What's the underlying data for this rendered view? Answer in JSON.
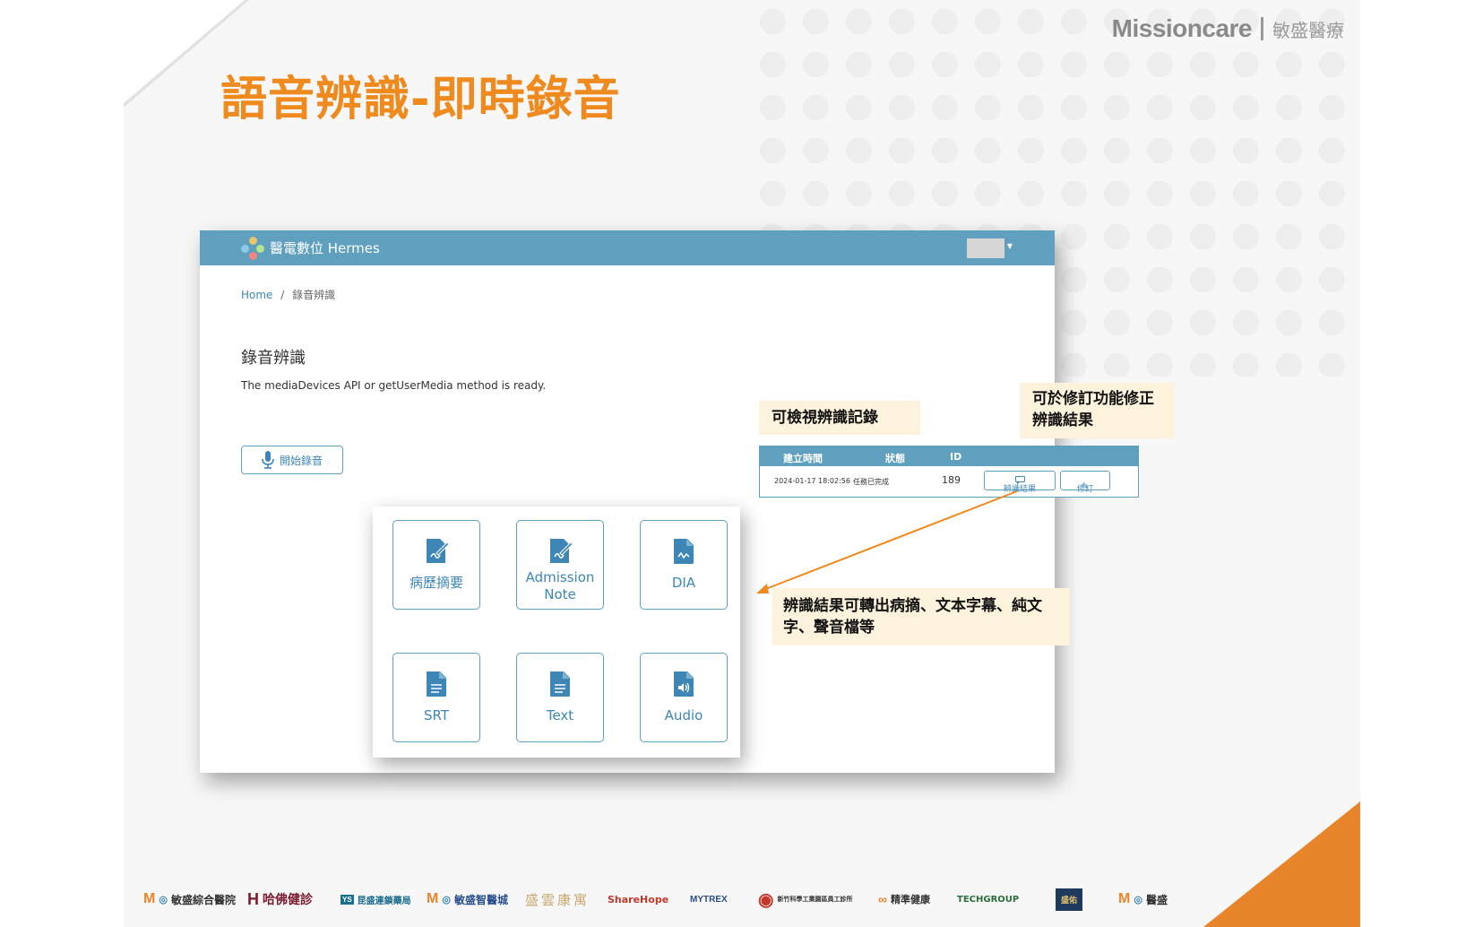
{
  "slide": {
    "brand_en": "Missioncare",
    "brand_zh": "敏盛醫療",
    "title": "語音辨識-即時錄音"
  },
  "app": {
    "name": "醫電數位 Hermes",
    "breadcrumb": {
      "home": "Home",
      "separator": "/",
      "current": "錄音辨識"
    },
    "heading": "錄音辨識",
    "status_message": "The mediaDevices API or getUserMedia method is ready.",
    "record_button": "開始錄音",
    "table": {
      "headers": [
        "建立時間",
        "狀態",
        "ID"
      ],
      "row": {
        "created": "2024-01-17 18:02:56",
        "status": "任務已完成",
        "id": "189"
      },
      "result_button": "辨識結果",
      "edit_button": "修訂"
    },
    "export_options": [
      {
        "label": "病歷摘要",
        "icon": "document-edit-icon"
      },
      {
        "label": "Admission Note",
        "icon": "document-edit-icon"
      },
      {
        "label": "DIA",
        "icon": "file-chart-icon"
      },
      {
        "label": "SRT",
        "icon": "file-text-icon"
      },
      {
        "label": "Text",
        "icon": "file-text-icon"
      },
      {
        "label": "Audio",
        "icon": "file-audio-icon"
      }
    ]
  },
  "callouts": {
    "view_records": "可檢視辨識記錄",
    "revise": "可於修訂功能修正辨識結果",
    "export": "辨識結果可轉出病摘、文本字幕、純文字、聲音檔等"
  },
  "partner_logos": [
    "敏盛綜合醫院",
    "哈佛健診",
    "昆盛連鎖藥局",
    "敏盛智醫城",
    "盛雲康寓",
    "ShareHope",
    "MYTREX",
    "新竹科學工業園區員工診所",
    "精準健康",
    "TECHGROUP",
    "盛佑",
    "醫盛"
  ],
  "colors": {
    "title": "#ef8a1e",
    "header": "#5fa0bf",
    "accent": "#3d86b5",
    "callout_bg": "#fdf3dc"
  }
}
